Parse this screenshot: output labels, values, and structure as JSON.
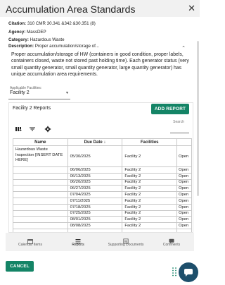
{
  "window": {
    "title": "Accumulation Area Standards"
  },
  "meta": {
    "citation_label": "Citation:",
    "citation_value": "310 CMR 30.341 &342 &30.351 (8)",
    "agency_label": "Agency:",
    "agency_value": "MassDEP",
    "category_label": "Category:",
    "category_value": "Hazardous Waste",
    "description_label": "Description:",
    "description_value": "Proper accumulation/storage of...",
    "description_full": "Proper accumulation/storage of HW (containers in good condition, proper labels, containers closed, waste not stored past holding time). Each generator status (very small quantity generator, small quantity generator, large quantity generator) has unique accumulation area requirements."
  },
  "facility_select": {
    "label": "Applicable Facilities:",
    "value": "Facility 2"
  },
  "reports": {
    "title": "Facility 2 Reports",
    "add_button": "ADD REPORT",
    "search_placeholder": "Search",
    "columns": {
      "name": "Name",
      "due": "Due Date",
      "facility": "Facilities",
      "status": ""
    },
    "rows": [
      {
        "name": "Hazardous Waste Inspection [INSERT DATE HERE]",
        "due": "05/30/2025",
        "facility": "Facility 2",
        "status": "Open"
      },
      {
        "name": "",
        "due": "06/06/2025",
        "facility": "Facility 2",
        "status": "Open"
      },
      {
        "name": "",
        "due": "06/13/2025",
        "facility": "Facility 2",
        "status": "Open"
      },
      {
        "name": "",
        "due": "06/20/2025",
        "facility": "Facility 2",
        "status": "Open"
      },
      {
        "name": "",
        "due": "06/27/2025",
        "facility": "Facility 2",
        "status": "Open"
      },
      {
        "name": "",
        "due": "07/04/2025",
        "facility": "Facility 2",
        "status": "Open"
      },
      {
        "name": "",
        "due": "07/11/2025",
        "facility": "Facility 2",
        "status": "Open"
      },
      {
        "name": "",
        "due": "07/18/2025",
        "facility": "Facility 2",
        "status": "Open"
      },
      {
        "name": "",
        "due": "07/25/2025",
        "facility": "Facility 2",
        "status": "Open"
      },
      {
        "name": "",
        "due": "08/01/2025",
        "facility": "Facility 2",
        "status": "Open"
      },
      {
        "name": "",
        "due": "08/08/2025",
        "facility": "Facility 2",
        "status": "Open"
      },
      {
        "name": "",
        "due": "",
        "facility": "",
        "status": ""
      }
    ]
  },
  "bottom_nav": [
    {
      "label": "Calendar Items",
      "icon": "calendar-icon"
    },
    {
      "label": "Reports",
      "icon": "reports-icon"
    },
    {
      "label": "Supporting Documents",
      "icon": "documents-icon"
    },
    {
      "label": "Comments",
      "icon": "comments-icon"
    }
  ],
  "actions": {
    "cancel": "CANCEL"
  },
  "colors": {
    "accent": "#148466",
    "chat": "#1d4f6b",
    "header_bg": "#f1f1f1"
  }
}
